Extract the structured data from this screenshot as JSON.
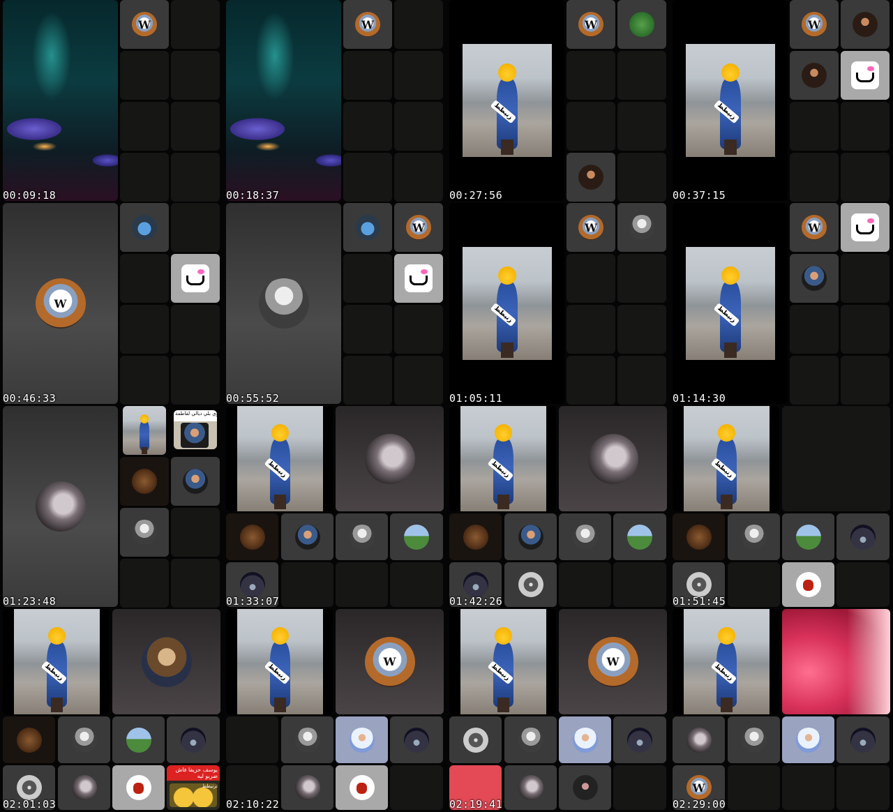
{
  "contact_sheet": {
    "frames": [
      {
        "timestamp": "00:09:18"
      },
      {
        "timestamp": "00:18:37"
      },
      {
        "timestamp": "00:27:56"
      },
      {
        "timestamp": "00:37:15"
      },
      {
        "timestamp": "00:46:33"
      },
      {
        "timestamp": "00:55:52"
      },
      {
        "timestamp": "01:05:11"
      },
      {
        "timestamp": "01:14:30"
      },
      {
        "timestamp": "01:23:48"
      },
      {
        "timestamp": "01:33:07"
      },
      {
        "timestamp": "01:42:26"
      },
      {
        "timestamp": "01:51:45"
      },
      {
        "timestamp": "02:01:03"
      },
      {
        "timestamp": "02:10:22"
      },
      {
        "timestamp": "02:19:41"
      },
      {
        "timestamp": "02:29:00"
      }
    ],
    "sticker_text": "زنيطط",
    "meme_caption": "يوسف حزيفا فاش ضربو ليه",
    "meme_caption_2": "ترنيطط",
    "screenshot_caption": "زنجوي بلي ديالي لفاطمة"
  }
}
